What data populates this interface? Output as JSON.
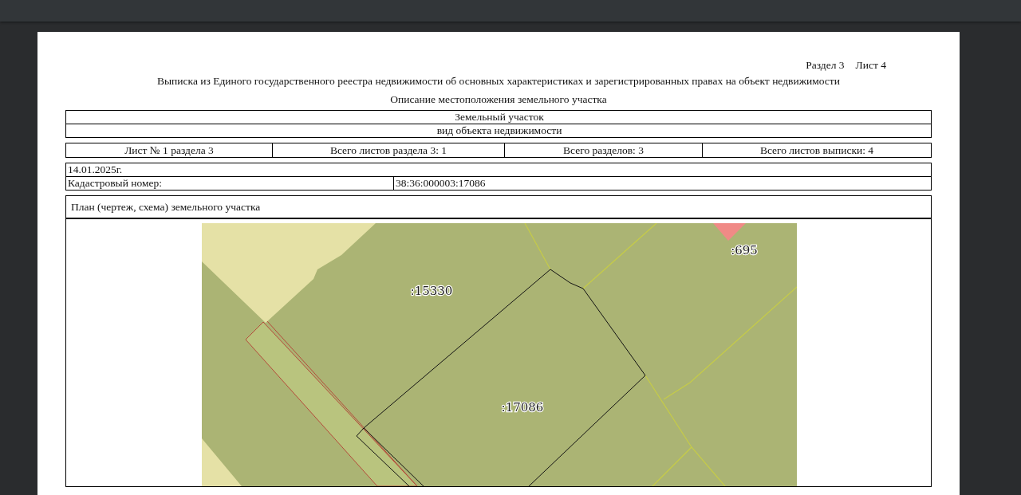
{
  "document": {
    "section_sheet": [
      "Раздел 3",
      "Лист 4"
    ],
    "title": "Выписка из Единого государственного реестра недвижимости об основных характеристиках и зарегистрированных правах на объект недвижимости",
    "subtitle": "Описание местоположения земельного участка",
    "object_rows": [
      "Земельный участок",
      "вид объекта недвижимости"
    ],
    "sheet_info": [
      "Лист № 1 раздела 3",
      "Всего листов раздела 3: 1",
      "Всего разделов: 3",
      "Всего листов выписки: 4"
    ],
    "date": "14.01.2025г.",
    "cadastral": {
      "label": "Кадастровый номер:",
      "value": "38:36:000003:17086"
    },
    "plan": {
      "title": "План (чертеж, схема) земельного участка",
      "map_labels": [
        ":15330",
        ":17086",
        ":695"
      ]
    }
  }
}
